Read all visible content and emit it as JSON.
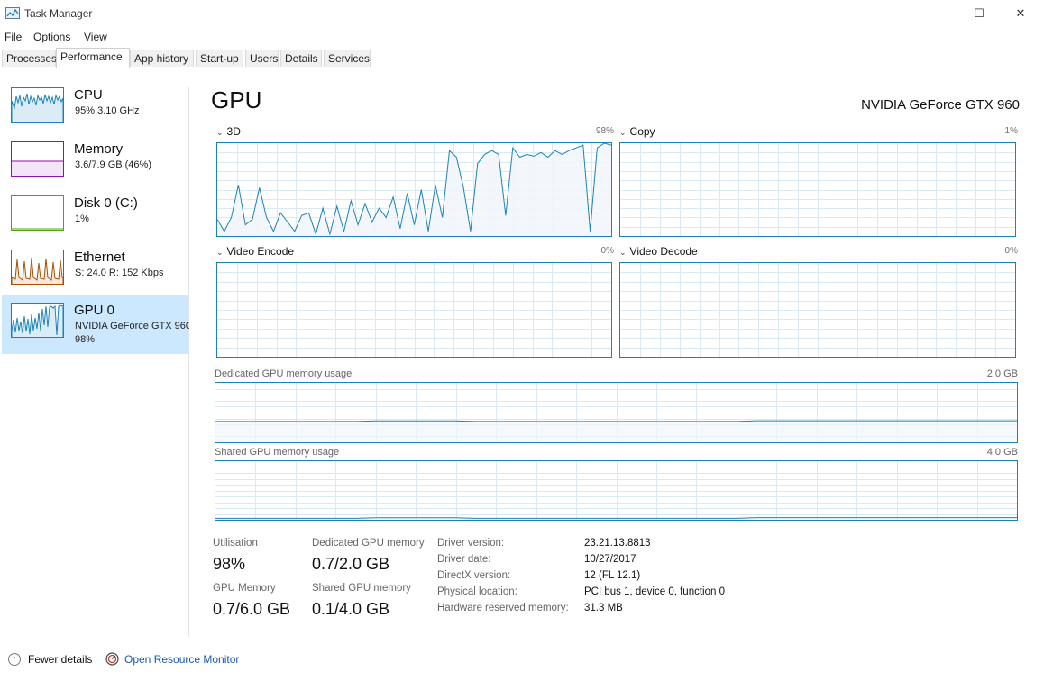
{
  "window": {
    "title": "Task Manager",
    "controls": [
      "—",
      "☐",
      "✕"
    ]
  },
  "menu": [
    "File",
    "Options",
    "View"
  ],
  "tabs": [
    {
      "label": "Processes"
    },
    {
      "label": "Performance"
    },
    {
      "label": "App history"
    },
    {
      "label": "Start-up"
    },
    {
      "label": "Users"
    },
    {
      "label": "Details"
    },
    {
      "label": "Services"
    }
  ],
  "active_tab": "Performance",
  "sidebar": {
    "items": [
      {
        "title": "CPU",
        "line1": "95% 3.10 GHz",
        "line2": "",
        "color": "#1a83b5"
      },
      {
        "title": "Memory",
        "line1": "3.6/7.9 GB (46%)",
        "line2": "",
        "color": "#8b12ae"
      },
      {
        "title": "Disk 0 (C:)",
        "line1": "1%",
        "line2": "",
        "color": "#4da60c"
      },
      {
        "title": "Ethernet",
        "line1": "S: 24.0  R: 152 Kbps",
        "line2": "",
        "color": "#a74f01"
      },
      {
        "title": "GPU 0",
        "line1": "NVIDIA GeForce GTX 960",
        "line2": "98%",
        "color": "#1a83b5",
        "selected": true
      }
    ]
  },
  "main": {
    "title": "GPU",
    "device_name": "NVIDIA GeForce GTX 960",
    "engines": [
      {
        "name": "3D",
        "percent": "98%",
        "utilization": 0.98
      },
      {
        "name": "Copy",
        "percent": "1%",
        "utilization": 0.01
      },
      {
        "name": "Video Encode",
        "percent": "0%",
        "utilization": 0
      },
      {
        "name": "Video Decode",
        "percent": "0%",
        "utilization": 0
      }
    ],
    "dedicated_memory": {
      "label": "Dedicated GPU memory usage",
      "max": "2.0 GB",
      "fraction": 0.35
    },
    "shared_memory": {
      "label": "Shared GPU memory usage",
      "max": "4.0 GB",
      "fraction": 0.025
    },
    "stats": {
      "utilisation_label": "Utilisation",
      "utilisation_value": "98%",
      "dedicated_label": "Dedicated GPU memory",
      "dedicated_value": "0.7/2.0 GB",
      "gpu_memory_label": "GPU Memory",
      "gpu_memory_value": "0.7/6.0 GB",
      "shared_label": "Shared GPU memory",
      "shared_value": "0.1/4.0 GB"
    },
    "driver": [
      {
        "label": "Driver version:",
        "value": "23.21.13.8813"
      },
      {
        "label": "Driver date:",
        "value": "10/27/2017"
      },
      {
        "label": "DirectX version:",
        "value": "12 (FL 12.1)"
      },
      {
        "label": "Physical location:",
        "value": "PCI bus 1, device 0, function 0"
      },
      {
        "label": "Hardware reserved memory:",
        "value": "31.3 MB"
      }
    ]
  },
  "footer": {
    "fewer_details": "Fewer details",
    "open_resource_monitor": "Open Resource Monitor"
  },
  "colors": {
    "gpu_line": "#1a83b5",
    "gpu_fill": "#f1f6fa",
    "grid": "#d9eaf4",
    "selected_bg": "#cce8ff",
    "link": "#1a5aa8"
  },
  "gpu_3d_history": [
    0.18,
    0.05,
    0.2,
    0.55,
    0.12,
    0.18,
    0.52,
    0.2,
    0.05,
    0.25,
    0.15,
    0.05,
    0.22,
    0.25,
    0.02,
    0.3,
    0.02,
    0.32,
    0.05,
    0.38,
    0.12,
    0.35,
    0.15,
    0.3,
    0.2,
    0.42,
    0.08,
    0.46,
    0.12,
    0.5,
    0.05,
    0.55,
    0.2,
    0.92,
    0.85,
    0.52,
    0.05,
    0.78,
    0.88,
    0.92,
    0.88,
    0.22,
    0.95,
    0.85,
    0.88,
    0.86,
    0.9,
    0.85,
    0.92,
    0.88,
    0.92,
    0.95,
    0.98,
    0.05,
    0.95,
    1.0,
    0.98
  ]
}
